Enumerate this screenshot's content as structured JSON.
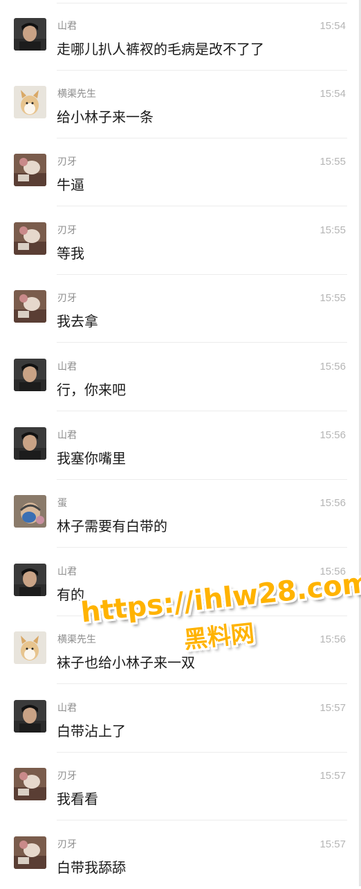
{
  "messages": [
    {
      "sender": "山君",
      "avatar": "avatar-shanjun",
      "time": "15:54",
      "text": "走哪儿扒人裤衩的毛病是改不了了"
    },
    {
      "sender": "横渠先生",
      "avatar": "avatar-hengqu",
      "time": "15:54",
      "text": "给小林子来一条"
    },
    {
      "sender": "刃牙",
      "avatar": "avatar-renya",
      "time": "15:55",
      "text": "牛逼"
    },
    {
      "sender": "刃牙",
      "avatar": "avatar-renya",
      "time": "15:55",
      "text": "等我"
    },
    {
      "sender": "刃牙",
      "avatar": "avatar-renya",
      "time": "15:55",
      "text": "我去拿"
    },
    {
      "sender": "山君",
      "avatar": "avatar-shanjun",
      "time": "15:56",
      "text": "行，你来吧"
    },
    {
      "sender": "山君",
      "avatar": "avatar-shanjun",
      "time": "15:56",
      "text": "我塞你嘴里"
    },
    {
      "sender": "蛋",
      "avatar": "avatar-dan",
      "time": "15:56",
      "text": "林子需要有白带的"
    },
    {
      "sender": "山君",
      "avatar": "avatar-shanjun",
      "time": "15:56",
      "text": "有的"
    },
    {
      "sender": "横渠先生",
      "avatar": "avatar-hengqu",
      "time": "15:56",
      "text": "袜子也给小林子来一双"
    },
    {
      "sender": "山君",
      "avatar": "avatar-shanjun",
      "time": "15:57",
      "text": "白带沾上了"
    },
    {
      "sender": "刃牙",
      "avatar": "avatar-renya",
      "time": "15:57",
      "text": "我看看"
    },
    {
      "sender": "刃牙",
      "avatar": "avatar-renya",
      "time": "15:57",
      "text": "白带我舔舔"
    }
  ],
  "watermark": {
    "url": "https://ihlw28.com",
    "label": "黑料网"
  }
}
